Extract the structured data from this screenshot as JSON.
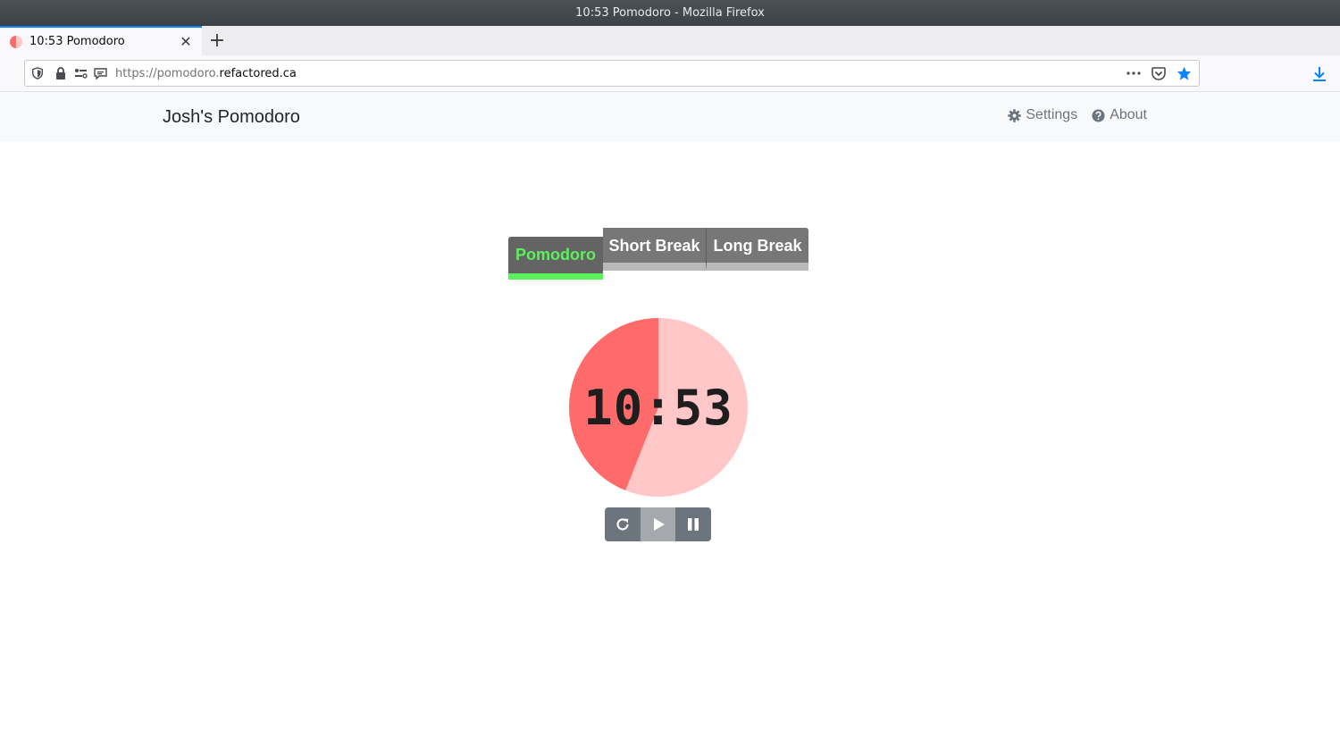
{
  "window": {
    "title": "10:53 Pomodoro - Mozilla Firefox"
  },
  "browser": {
    "tab_title": "10:53 Pomodoro",
    "url_prefix": "https://pomodoro.",
    "url_domain": "refactored.ca"
  },
  "app": {
    "brand": "Josh's Pomodoro",
    "nav": {
      "settings": "Settings",
      "about": "About"
    },
    "modes": {
      "pomodoro": "Pomodoro",
      "short_break": "Short Break",
      "long_break": "Long Break"
    },
    "active_mode": "pomodoro",
    "timer": {
      "display": "10:53",
      "remaining_fraction": 0.44,
      "colors": {
        "remaining": "#ff6b6b",
        "elapsed": "#ffc7c7"
      }
    }
  },
  "colors": {
    "accent_green": "#5cf05c",
    "button_gray": "#6c757d",
    "firefox_blue": "#0a84ff"
  },
  "icons": [
    "shield-icon",
    "lock-icon",
    "permissions-icon",
    "reader-icon",
    "more-icon",
    "pocket-icon",
    "star-icon",
    "download-icon",
    "gear-icon",
    "question-icon",
    "reset-icon",
    "play-icon",
    "pause-icon",
    "close-icon",
    "plus-icon"
  ]
}
